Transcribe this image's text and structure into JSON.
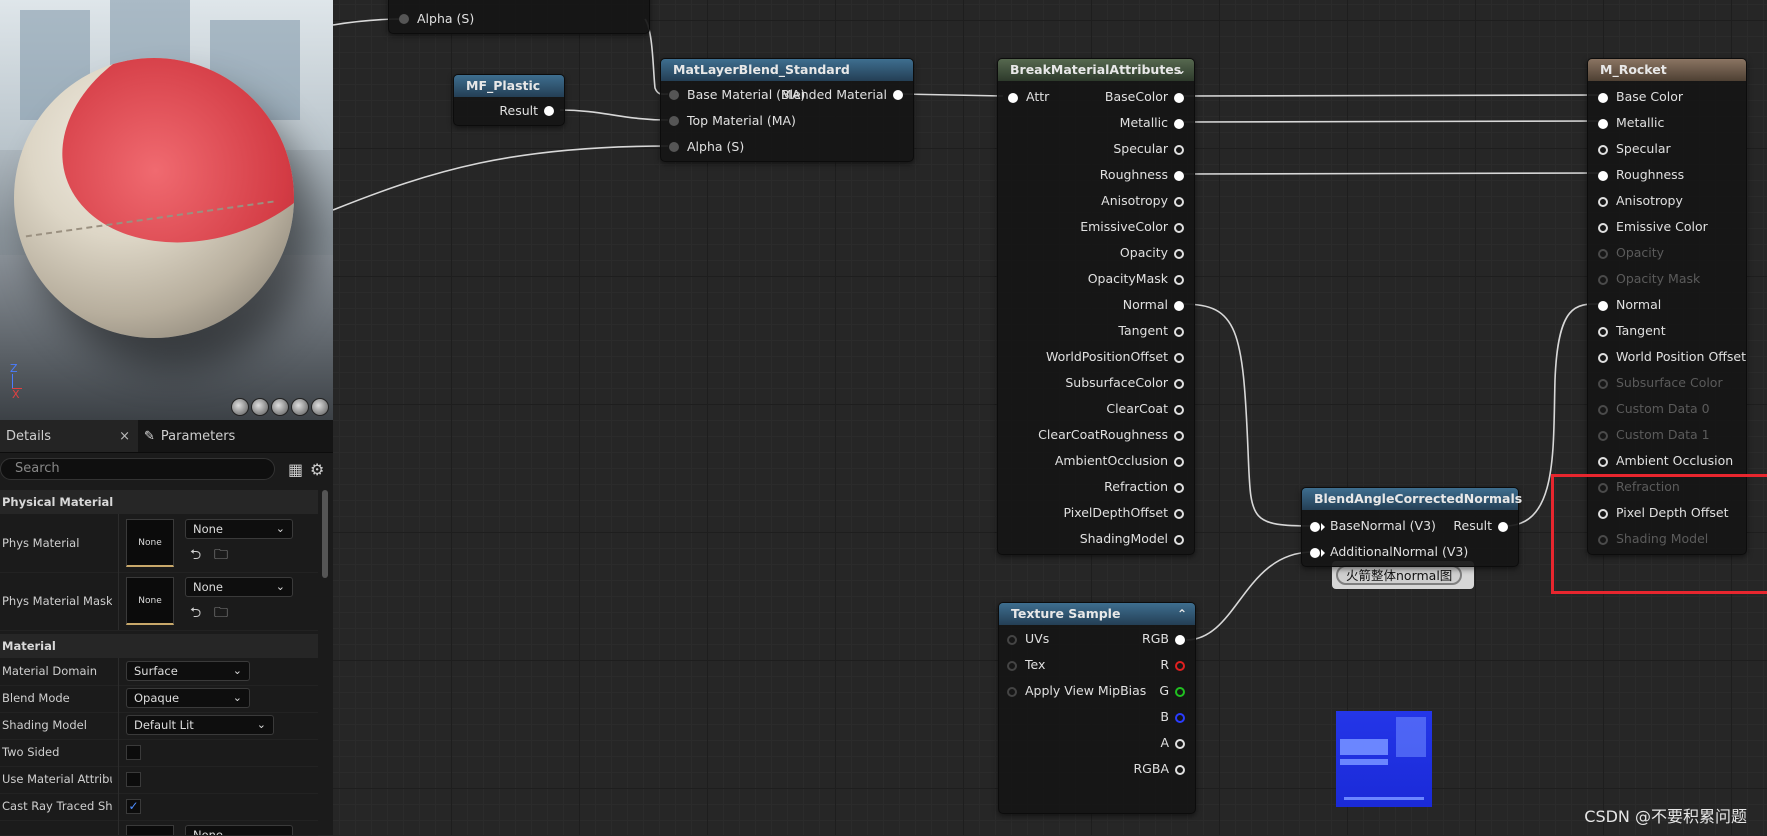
{
  "viewport": {
    "axis_z": "Z",
    "axis_x": "X"
  },
  "details": {
    "tabs": [
      {
        "label": "Details",
        "close": "×"
      },
      {
        "label": "Parameters"
      }
    ],
    "search_placeholder": "Search",
    "sections": {
      "physical_material": "Physical Material",
      "material": "Material"
    },
    "phys_material": {
      "label": "Phys Material",
      "thumb": "None",
      "value": "None"
    },
    "phys_material_mask": {
      "label": "Phys Material Mask",
      "thumb": "None",
      "value": "None"
    },
    "material_domain": {
      "label": "Material Domain",
      "value": "Surface"
    },
    "blend_mode": {
      "label": "Blend Mode",
      "value": "Opaque"
    },
    "shading_model": {
      "label": "Shading Model",
      "value": "Default Lit"
    },
    "two_sided": {
      "label": "Two Sided",
      "checked": false
    },
    "use_material_attributes": {
      "label": "Use Material Attribu…",
      "checked": false
    },
    "cast_ray_traced_shadows": {
      "label": "Cast Ray Traced Sh…",
      "checked": true
    },
    "partial_dropdown": "None"
  },
  "graph": {
    "top_node_pin": "Alpha (S)",
    "mf_plastic": {
      "title": "MF_Plastic",
      "output": "Result"
    },
    "mat_layer_blend": {
      "title": "MatLayerBlend_Standard",
      "inputs": [
        "Base Material (MA)",
        "Top Material (MA)",
        "Alpha (S)"
      ],
      "output": "Blended Material"
    },
    "break_material_attributes": {
      "title": "BreakMaterialAttributes",
      "input": "Attr",
      "outputs": [
        "BaseColor",
        "Metallic",
        "Specular",
        "Roughness",
        "Anisotropy",
        "EmissiveColor",
        "Opacity",
        "OpacityMask",
        "Normal",
        "Tangent",
        "WorldPositionOffset",
        "SubsurfaceColor",
        "ClearCoat",
        "ClearCoatRoughness",
        "AmbientOcclusion",
        "Refraction",
        "PixelDepthOffset",
        "ShadingModel"
      ]
    },
    "m_rocket": {
      "title": "M_Rocket",
      "inputs": [
        "Base Color",
        "Metallic",
        "Specular",
        "Roughness",
        "Anisotropy",
        "Emissive Color",
        "Opacity",
        "Opacity Mask",
        "Normal",
        "Tangent",
        "World Position Offset",
        "Subsurface Color",
        "Custom Data 0",
        "Custom Data 1",
        "Ambient Occlusion",
        "Refraction",
        "Pixel Depth Offset",
        "Shading Model"
      ]
    },
    "blend_normals": {
      "title": "BlendAngleCorrectedNormals",
      "inputs": [
        "BaseNormal (V3)",
        "AdditionalNormal (V3)"
      ],
      "output": "Result"
    },
    "comment": "火箭整体normal图",
    "texture_sample": {
      "title": "Texture Sample",
      "inputs": [
        "UVs",
        "Tex",
        "Apply View MipBias"
      ],
      "outputs": [
        "RGB",
        "R",
        "G",
        "B",
        "A",
        "RGBA"
      ],
      "pin_colors": {
        "R": "#e02020",
        "G": "#20c020",
        "B": "#2a3cff"
      }
    }
  },
  "watermark": "CSDN @不要积累问题"
}
